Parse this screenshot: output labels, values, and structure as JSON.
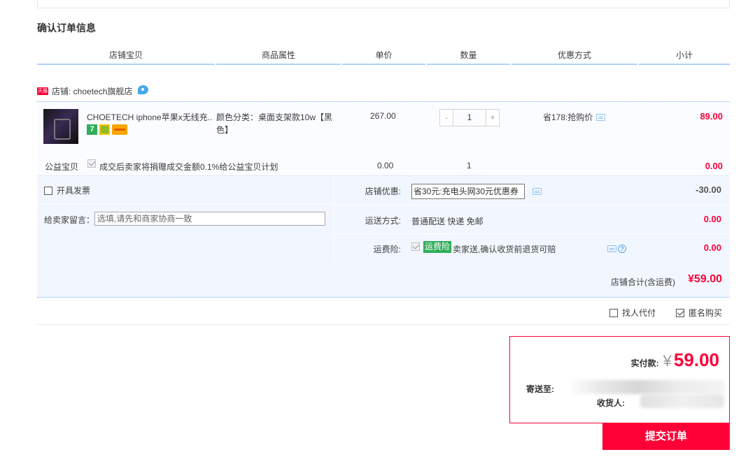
{
  "page": {
    "title": "确认订单信息"
  },
  "columns": [
    "店铺宝贝",
    "商品属性",
    "单价",
    "数量",
    "优惠方式",
    "小计"
  ],
  "shop": {
    "badge": "天猫",
    "name_label": "店铺: choetech旗舰店"
  },
  "item": {
    "title": "CHOETECH iphone苹果x无线充...",
    "attributes": "颜色分类：桌面支架款10w【黑色】",
    "unit_price": "267.00",
    "quantity_minus": "-",
    "quantity": "1",
    "quantity_plus": "+",
    "promotion": "省178:抢购价",
    "subtotal": "89.00",
    "service_7": "7"
  },
  "charity": {
    "label": "公益宝贝",
    "desc": "成交后卖家将捐赠成交金额0.1%给公益宝贝计划",
    "price": "0.00",
    "quantity": "1",
    "subtotal": "0.00"
  },
  "invoice": {
    "label": "开具发票",
    "checked": false
  },
  "message": {
    "label": "给卖家留言：",
    "placeholder": "选填,请先和商家协商一致"
  },
  "coupon": {
    "label": "店铺优惠:",
    "selected": "省30元:充电头网30元优惠券",
    "amount": "-30.00"
  },
  "shipping": {
    "label": "运送方式:",
    "method": "普通配送 快递 免邮",
    "amount": "0.00"
  },
  "insurance": {
    "label": "运费险:",
    "tag": "运费险",
    "desc": "卖家送,确认收货前退货可赔",
    "amount": "0.00",
    "help": "?"
  },
  "shop_total": {
    "label": "店铺合计(含运费)",
    "value": "¥59.00"
  },
  "options": {
    "find_pay": "找人代付",
    "find_pay_checked": false,
    "anonymous": "匿名购买",
    "anonymous_checked": true
  },
  "summary": {
    "pay_label": "实付款:",
    "currency": "¥",
    "pay_amount": "59.00",
    "ship_to_label": "寄送至:",
    "receiver_label": "收货人:"
  },
  "submit": {
    "label": "提交订单"
  },
  "colors": {
    "accent": "#ff0036",
    "panel_bg": "#f2f7ff",
    "header_line": "#b2d1ff"
  }
}
